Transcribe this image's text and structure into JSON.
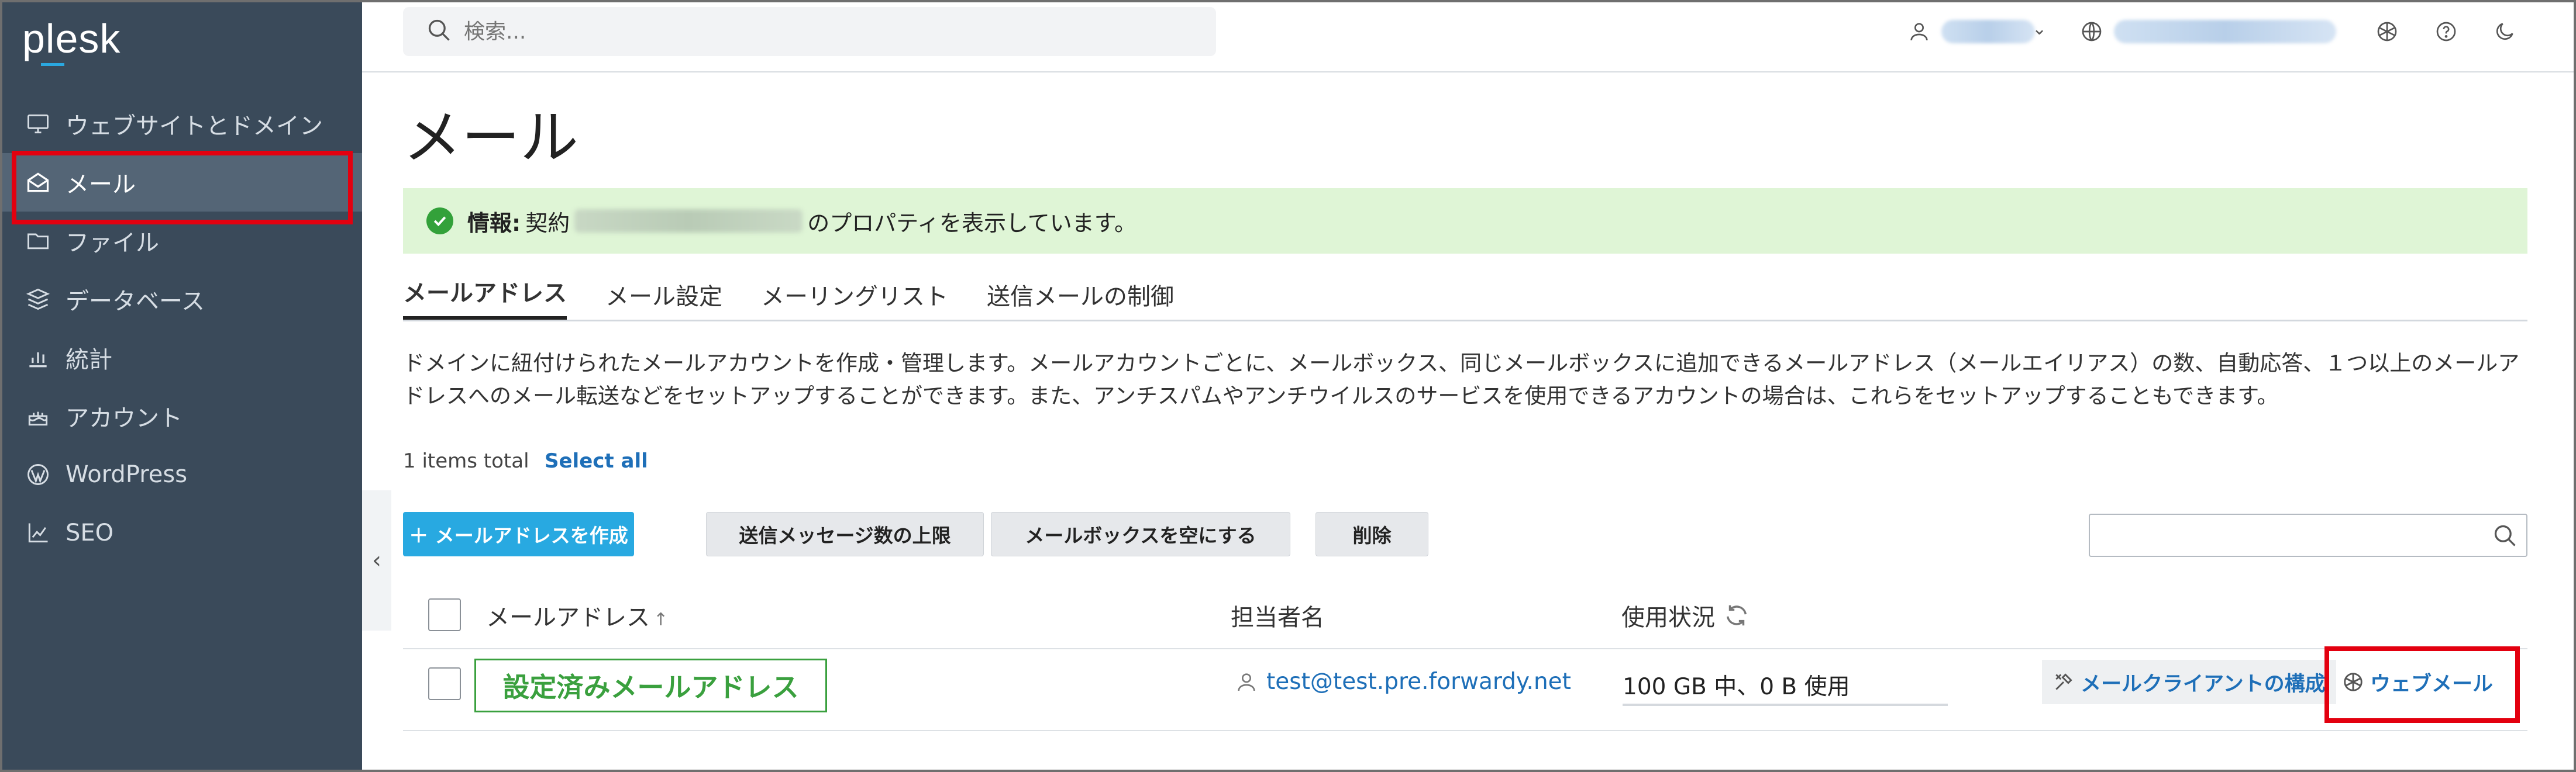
{
  "sidebar": {
    "logo": "plesk",
    "items": [
      {
        "label": "ウェブサイトとドメイン",
        "icon": "monitor-icon"
      },
      {
        "label": "メール",
        "icon": "mail-envelope-icon",
        "active": true
      },
      {
        "label": "ファイル",
        "icon": "folder-icon"
      },
      {
        "label": "データベース",
        "icon": "database-layers-icon"
      },
      {
        "label": "統計",
        "icon": "bar-chart-icon"
      },
      {
        "label": "アカウント",
        "icon": "account-cake-icon"
      },
      {
        "label": "WordPress",
        "icon": "wordpress-icon"
      },
      {
        "label": "SEO",
        "icon": "seo-chart-icon"
      }
    ],
    "collapse_glyph": "‹"
  },
  "topbar": {
    "search_placeholder": "検索...",
    "icons": [
      "user-icon",
      "globe-icon",
      "plesk-logo-icon",
      "help-icon",
      "moon-icon"
    ]
  },
  "page": {
    "title": "メール",
    "info_banner": {
      "label": "情報:",
      "prefix": "契約",
      "suffix": "のプロパティを表示しています。"
    },
    "tabs": [
      {
        "label": "メールアドレス",
        "active": true
      },
      {
        "label": "メール設定"
      },
      {
        "label": "メーリングリスト"
      },
      {
        "label": "送信メールの制御"
      }
    ],
    "description": "ドメインに紐付けられたメールアカウントを作成・管理します。メールアカウントごとに、メールボックス、同じメールボックスに追加できるメールアドレス（メールエイリアス）の数、自動応答、１つ以上のメールアドレスへのメール転送などをセットアップすることができます。また、アンチスパムやアンチウイルスのサービスを使用できるアカウントの場合は、これらをセットアップすることもできます。",
    "items_total": "1 items total",
    "select_all": "Select all"
  },
  "toolbar": {
    "create_label": "＋ メールアドレスを作成",
    "send_limit_label": "送信メッセージ数の上限",
    "empty_mailbox_label": "メールボックスを空にする",
    "delete_label": "削除"
  },
  "table": {
    "headers": {
      "address": "メールアドレス",
      "sort_glyph": "↑",
      "owner": "担当者名",
      "usage": "使用状況"
    },
    "rows": [
      {
        "address": "設定済みメールアドレス",
        "owner": "test@test.pre.forwardy.net",
        "usage": "100 GB 中、0 B 使用",
        "actions": {
          "mail_client": "メールクライアントの構成",
          "webmail": "ウェブメール"
        }
      }
    ]
  },
  "colors": {
    "sidebar_bg": "#3a4a5a",
    "sidebar_active": "#546576",
    "primary_button": "#28a9e1",
    "success_green": "#33a13a",
    "link_blue": "#1e6fb8",
    "highlight_red": "#e3000f"
  }
}
